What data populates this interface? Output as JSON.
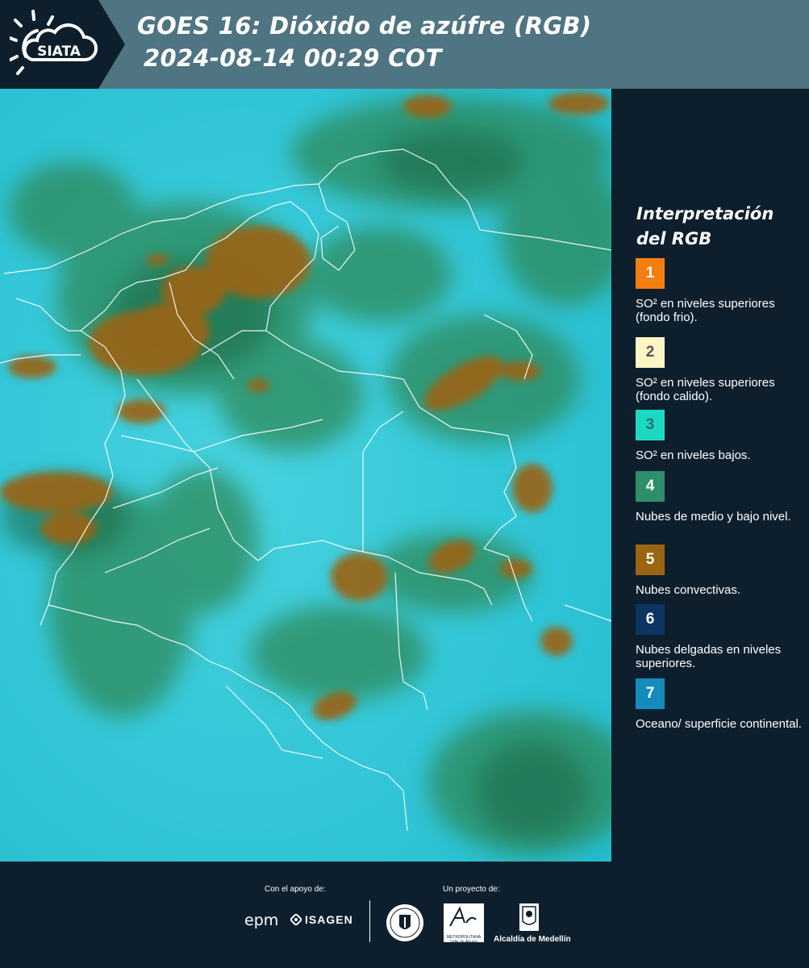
{
  "header": {
    "logo_text": "SIATA",
    "title_line1": "GOES 16: Dióxido de azúfre (RGB)",
    "title_line2": "2024-08-14 00:29 COT"
  },
  "legend": {
    "title": "Interpretación del RGB",
    "items": [
      {
        "number": "1",
        "color": "#f47f10",
        "number_color": "#ffffff",
        "label": "SO² en niveles superiores (fondo frio)."
      },
      {
        "number": "2",
        "color": "#fdf5c4",
        "number_color": "#555555",
        "label": "SO² en niveles superiores (fondo calido)."
      },
      {
        "number": "3",
        "color": "#1dd9c2",
        "number_color": "#2a6e6a",
        "label": "SO² en niveles bajos."
      },
      {
        "number": "4",
        "color": "#2f8f6b",
        "number_color": "#ffffff",
        "label": "Nubes de medio y bajo nivel."
      },
      {
        "number": "5",
        "color": "#9a6512",
        "number_color": "#ffffff",
        "label": "Nubes convectivas."
      },
      {
        "number": "6",
        "color": "#0c3562",
        "number_color": "#ffffff",
        "label": "Nubes delgadas en niveles superiores."
      },
      {
        "number": "7",
        "color": "#138cbb",
        "number_color": "#ffffff",
        "label": "Oceano/ superficie continental."
      }
    ]
  },
  "footer": {
    "support_label": "Con el apoyo de:",
    "project_label": "Un proyecto de:",
    "epm": "epm",
    "isagen": "ISAGEN",
    "area_line1": "METROPOLITANA",
    "area_line2": "Valle de Aburrá",
    "alcaldia": "Alcaldía de Medellín"
  },
  "colors": {
    "background": "#0d1f2d",
    "header": "#4f7482",
    "map_base": "#2ec6d6",
    "cloud_green": "#2f8f6b",
    "convective": "#9a6512"
  }
}
